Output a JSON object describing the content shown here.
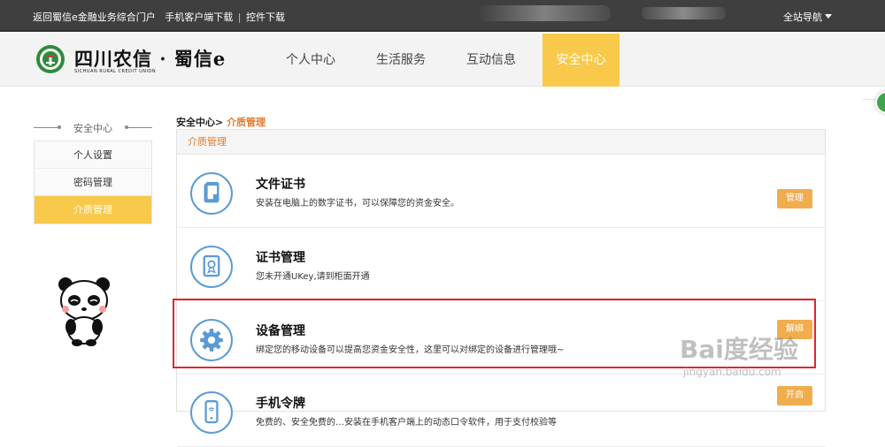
{
  "topbar": {
    "link_portal": "返回蜀信e金融业务综合门户",
    "link_mobile": "手机客户端下载",
    "separator": "|",
    "link_plugin": "控件下载",
    "site_nav": "全站导航"
  },
  "header": {
    "logo_cn": "四川农信 · 蜀信e",
    "logo_en": "SICHUAN RURAL CREDIT UNION",
    "nav": [
      {
        "label": "个人中心"
      },
      {
        "label": "生活服务"
      },
      {
        "label": "互动信息"
      },
      {
        "label": "安全中心",
        "active": true
      }
    ]
  },
  "sidebar": {
    "title": "安全中心",
    "items": [
      {
        "label": "个人设置"
      },
      {
        "label": "密码管理"
      },
      {
        "label": "介质管理",
        "active": true
      }
    ]
  },
  "breadcrumb": {
    "parent": "安全中心>",
    "current": "介质管理"
  },
  "panel": {
    "header": "介质管理",
    "rows": [
      {
        "icon": "certificate-file-icon",
        "title": "文件证书",
        "desc": "安装在电脑上的数字证书，可以保障您的资金安全。",
        "button": "管理"
      },
      {
        "icon": "certificate-manage-icon",
        "title": "证书管理",
        "desc": "您未开通UKey,请到柜面开通",
        "button": ""
      },
      {
        "icon": "gear-icon",
        "title": "设备管理",
        "desc": "绑定您的移动设备可以提高您资金安全性，这里可以对绑定的设备进行管理哦~",
        "button": "解绑"
      },
      {
        "icon": "mobile-token-icon",
        "title": "手机令牌",
        "desc": "免费的、安全免费的…安装在手机客户端上的动态口令软件，用于支付校验等",
        "button": "开启"
      }
    ]
  },
  "watermark": {
    "brand": "Bai度经验",
    "url": "jingyan.baidu.com"
  },
  "colors": {
    "accent_yellow": "#f8c94a",
    "button_orange": "#f0ad4e",
    "icon_blue": "#5b9bd5",
    "highlight_red": "#e0262a",
    "breadcrumb_orange": "#e2792b"
  }
}
